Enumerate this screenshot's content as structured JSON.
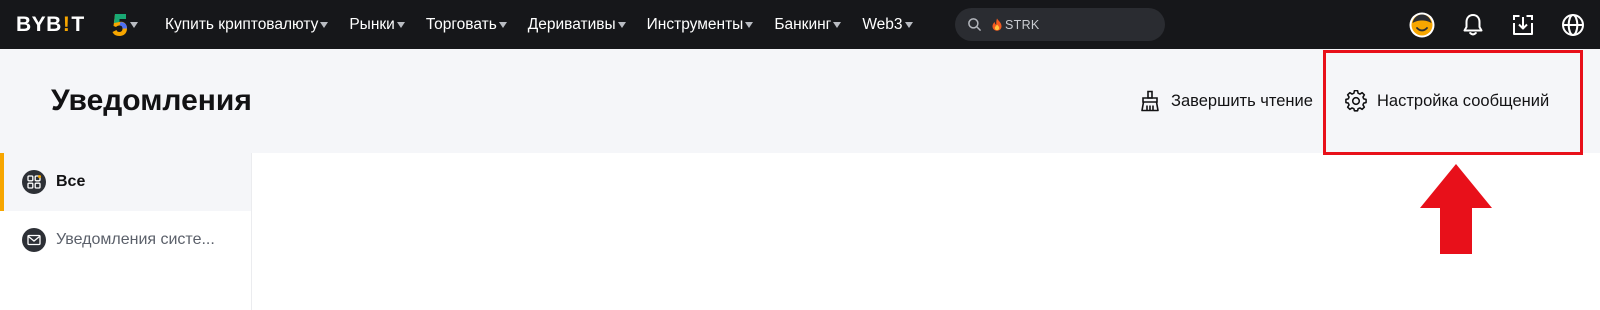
{
  "topbar": {
    "logo": {
      "left": "BYB",
      "bang": "!",
      "right": "T"
    },
    "anniversary_badge": "5",
    "nav": [
      {
        "label": "Купить криптовалюту",
        "has_dropdown": true
      },
      {
        "label": "Рынки",
        "has_dropdown": true
      },
      {
        "label": "Торговать",
        "has_dropdown": true
      },
      {
        "label": "Деривативы",
        "has_dropdown": true
      },
      {
        "label": "Инструменты",
        "has_dropdown": true
      },
      {
        "label": "Банкинг",
        "has_dropdown": true
      },
      {
        "label": "Web3",
        "has_dropdown": true
      }
    ],
    "search": {
      "placeholder": "STRK",
      "icon": "search-icon",
      "hot_icon": "fire-icon"
    },
    "right_icons": [
      "avatar",
      "bell-icon",
      "download-icon",
      "globe-icon"
    ]
  },
  "header": {
    "title": "Уведомления",
    "actions": {
      "mark_read": "Завершить чтение",
      "message_settings": "Настройка сообщений"
    }
  },
  "sidebar": {
    "items": [
      {
        "label": "Все",
        "icon": "grid-icon",
        "active": true
      },
      {
        "label": "Уведомления систе...",
        "icon": "envelope-icon",
        "active": false
      }
    ]
  },
  "colors": {
    "topbar_bg": "#16171a",
    "accent": "#f7a600",
    "header_bg": "#f5f6f9",
    "annotation_red": "#e8101a"
  }
}
